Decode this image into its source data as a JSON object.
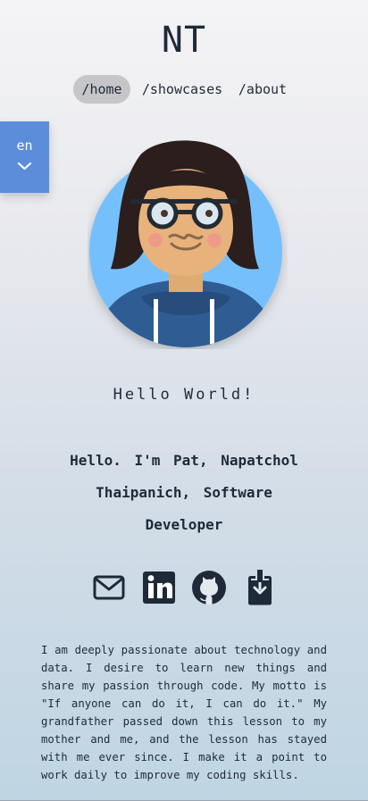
{
  "header": {
    "logo": "NT"
  },
  "nav": {
    "items": [
      {
        "label": "/home",
        "active": true
      },
      {
        "label": "/showcases",
        "active": false
      },
      {
        "label": "/about",
        "active": false
      }
    ]
  },
  "language": {
    "selected": "en",
    "icon": "chevron-down-icon"
  },
  "profile": {
    "greeting": "Hello World!",
    "intro": "Hello. I'm Pat, Napatchol Thaipanich, Software Developer",
    "about": "I am deeply passionate about technology and data. I desire to learn new things and share my passion through code. My motto is \"If anyone can do it, I can do it.\" My grandfather passed down this lesson to my mother and me, and the lesson has stayed with me ever since. I make it a point to work daily to improve my coding skills."
  },
  "socials": [
    {
      "icon": "mail-icon"
    },
    {
      "icon": "linkedin-icon"
    },
    {
      "icon": "github-icon"
    },
    {
      "icon": "download-icon"
    }
  ],
  "colors": {
    "accent": "#5b8ddb",
    "text": "#1f2a38",
    "nav_active_bg": "#c6c6c8",
    "avatar_bg": "#74c0fc"
  }
}
